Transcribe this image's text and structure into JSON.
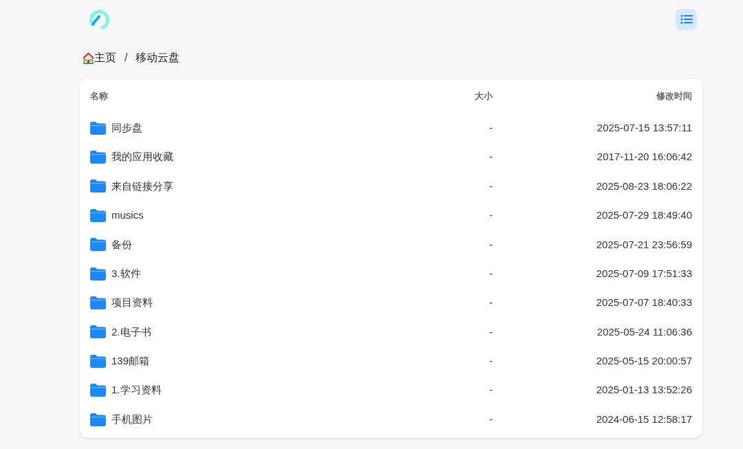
{
  "breadcrumb": [
    {
      "label": "主页"
    },
    {
      "label": "移动云盘"
    }
  ],
  "breadcrumb_separator": "/",
  "table": {
    "columns": [
      "名称",
      "大小",
      "修改时间"
    ],
    "rows": [
      {
        "name": "同步盘",
        "size": "-",
        "modified": "2025-07-15 13:57:11"
      },
      {
        "name": "我的应用收藏",
        "size": "-",
        "modified": "2017-11-20 16:06:42"
      },
      {
        "name": "来自链接分享",
        "size": "-",
        "modified": "2025-08-23 18:06:22"
      },
      {
        "name": "musics",
        "size": "-",
        "modified": "2025-07-29 18:49:40"
      },
      {
        "name": "备份",
        "size": "-",
        "modified": "2025-07-21 23:56:59"
      },
      {
        "name": "3.软件",
        "size": "-",
        "modified": "2025-07-09 17:51:33"
      },
      {
        "name": "项目资料",
        "size": "-",
        "modified": "2025-07-07 18:40:33"
      },
      {
        "name": "2.电子书",
        "size": "-",
        "modified": "2025-05-24 11:06:36"
      },
      {
        "name": "139邮箱",
        "size": "-",
        "modified": "2025-05-15 20:00:57"
      },
      {
        "name": "1.学习资料",
        "size": "-",
        "modified": "2025-01-13 13:52:26"
      },
      {
        "name": "手机图片",
        "size": "-",
        "modified": "2024-06-15 12:58:17"
      }
    ]
  }
}
